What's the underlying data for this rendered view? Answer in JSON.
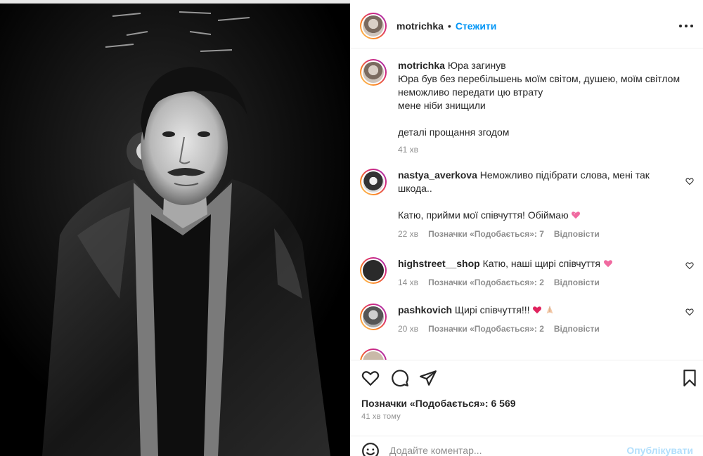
{
  "header": {
    "username": "motrichka",
    "separator": "•",
    "follow_label": "Стежити"
  },
  "caption": {
    "username": "motrichka",
    "title": "Юра загинув",
    "lines": [
      "Юра був без перебільшень моїм світом, душею, моїм світлом",
      "неможливо передати цю втрату",
      "мене ніби знищили",
      "деталі прощання згодом"
    ],
    "time": "41 хв"
  },
  "comments": [
    {
      "username": "nastya_averkova",
      "text_line1": "Неможливо підібрати слова, мені так",
      "text_line2": "шкода..",
      "text_line3": "Катю, прийми мої співчуття! Обіймаю",
      "time": "22 хв",
      "likes": "Позначки «Подобається»: 7",
      "reply": "Відповісти"
    },
    {
      "username": "highstreet__shop",
      "text": "Катю, наші щирі співчуття",
      "time": "14 хв",
      "likes": "Позначки «Подобається»: 2",
      "reply": "Відповісти"
    },
    {
      "username": "pashkovich",
      "text": "Щирі співчуття!!!",
      "time": "20 хв",
      "likes": "Позначки «Подобається»: 2",
      "reply": "Відповісти"
    }
  ],
  "footer": {
    "likes_count": "Позначки «Подобається»: 6 569",
    "posted_ago": "41 хв тому",
    "comment_placeholder": "Додайте коментар...",
    "publish_label": "Опублікувати"
  },
  "icons": {
    "header_more": "more-options-icon",
    "like": "heart-icon",
    "comment": "comment-icon",
    "share": "paper-plane-icon",
    "save": "bookmark-icon",
    "emoji": "smile-icon"
  },
  "colors": {
    "link_blue": "#0095f6",
    "publish_disabled": "#b2dffc",
    "muted_text": "#8e8e8e"
  }
}
